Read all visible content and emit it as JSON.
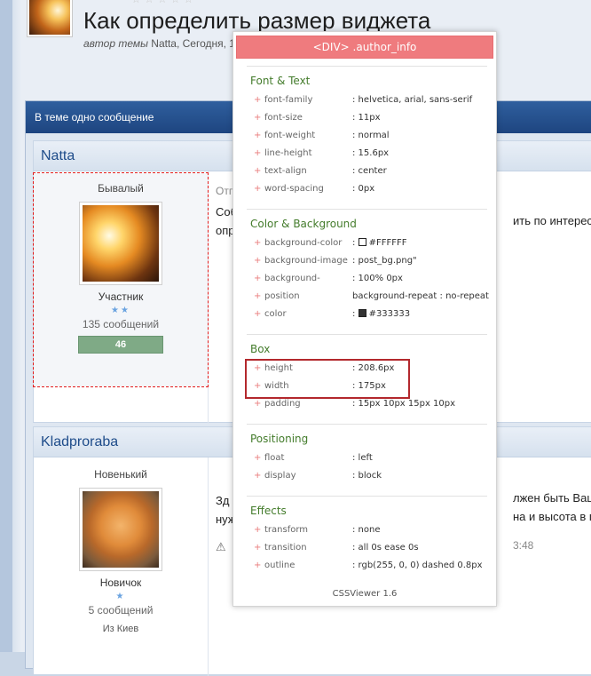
{
  "topic": {
    "title": "Как определить размер виджета",
    "meta_prefix": "автор темы",
    "meta_author": "Natta, Сегодня, 1",
    "rating_stars": "☆☆☆☆☆"
  },
  "container": {
    "header": "В теме одно сообщение"
  },
  "posts": [
    {
      "author": "Natta",
      "rank": "Бывалый",
      "group": "Участник",
      "pips": "★★",
      "post_count": "135 сообщений",
      "reputation": "46",
      "body_line1": "Отп",
      "body_line2": "Соб",
      "body_line3": "опр",
      "body_right": "ить по интересам"
    },
    {
      "author": "Kladproraba",
      "rank": "Новенький",
      "group": "Новичок",
      "pips": "★",
      "post_count": "5 сообщений",
      "city": "Из Киев",
      "body_line1": "Зд",
      "body_line2": "нуж",
      "body_right1": "лжен быть Ваш ви",
      "body_right2": "на и высота в пикс",
      "time": "3:48"
    }
  ],
  "viewer": {
    "title": "<DIV> .author_info",
    "footer": "CSSViewer 1.6",
    "sections": {
      "font": {
        "title": "Font & Text",
        "rows": [
          {
            "prop": "font-family",
            "val": ": helvetica, arial, sans-serif"
          },
          {
            "prop": "font-size",
            "val": ": 11px"
          },
          {
            "prop": "font-weight",
            "val": ": normal"
          },
          {
            "prop": "line-height",
            "val": ": 15.6px"
          },
          {
            "prop": "text-align",
            "val": ": center"
          },
          {
            "prop": "word-spacing",
            "val": ": 0px"
          }
        ]
      },
      "color": {
        "title": "Color & Background",
        "rows": [
          {
            "prop": "background-color",
            "val": "#FFFFFF",
            "swatch": "#FFFFFF"
          },
          {
            "prop": "background-image",
            "val": ": post_bg.png\""
          },
          {
            "prop": "background-",
            "val": ": 100% 0px"
          },
          {
            "prop": "position",
            "val": "background-repeat  : no-repeat"
          },
          {
            "prop": "color",
            "val": "#333333",
            "swatch": "#333333"
          }
        ]
      },
      "box": {
        "title": "Box",
        "rows": [
          {
            "prop": "height",
            "val": ": 208.6px"
          },
          {
            "prop": "width",
            "val": ": 175px"
          },
          {
            "prop": "padding",
            "val": ": 15px 10px 15px 10px"
          }
        ]
      },
      "positioning": {
        "title": "Positioning",
        "rows": [
          {
            "prop": "float",
            "val": ": left"
          },
          {
            "prop": "display",
            "val": ": block"
          }
        ]
      },
      "effects": {
        "title": "Effects",
        "rows": [
          {
            "prop": "transform",
            "val": ": none"
          },
          {
            "prop": "transition",
            "val": ": all 0s ease 0s"
          },
          {
            "prop": "outline",
            "val": ": rgb(255, 0, 0) dashed 0.8px"
          }
        ]
      }
    }
  },
  "colors": {
    "accent_header": "#1e4580",
    "viewer_title_bg": "#ef7b7e",
    "section_title": "#447c2c",
    "highlight_box": "#b3282d"
  }
}
